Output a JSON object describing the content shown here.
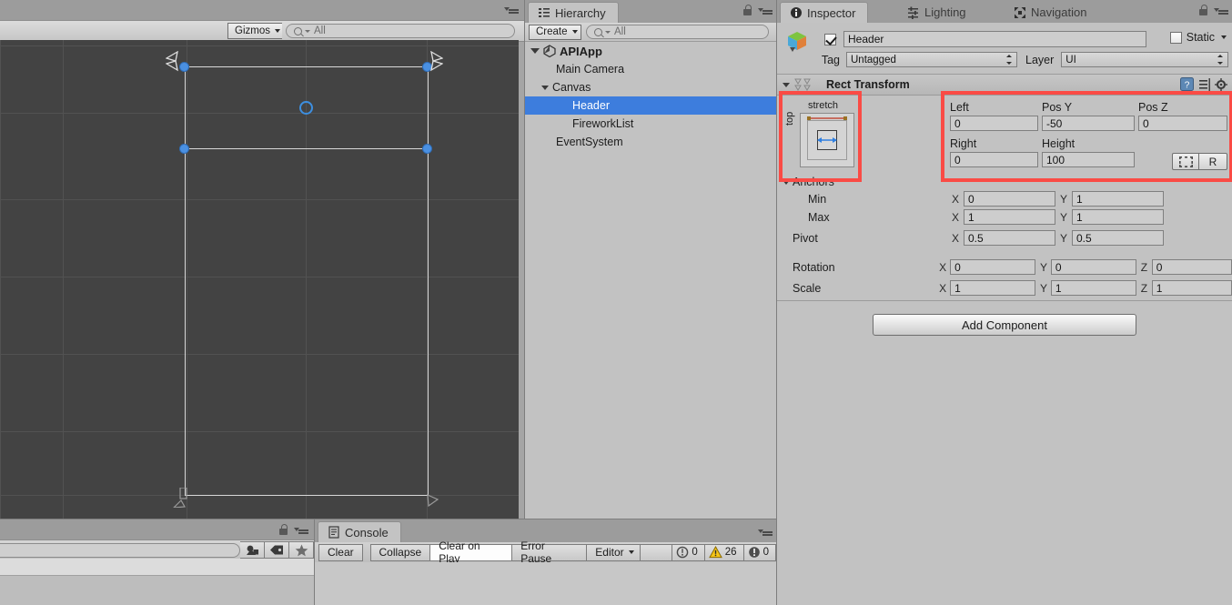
{
  "scene_view": {
    "gizmos_label": "Gizmos",
    "search_placeholder": "All",
    "search_value": ""
  },
  "hierarchy": {
    "tab_label": "Hierarchy",
    "create_label": "Create",
    "search_placeholder": "All",
    "search_value": "",
    "items": [
      {
        "label": "APIApp",
        "depth": 0,
        "expanded": true,
        "selected": false,
        "root": true
      },
      {
        "label": "Main Camera",
        "depth": 1,
        "expanded": null,
        "selected": false,
        "root": false
      },
      {
        "label": "Canvas",
        "depth": 1,
        "expanded": true,
        "selected": false,
        "root": false
      },
      {
        "label": "Header",
        "depth": 2,
        "expanded": null,
        "selected": true,
        "root": false
      },
      {
        "label": "FireworkList",
        "depth": 2,
        "expanded": null,
        "selected": false,
        "root": false
      },
      {
        "label": "EventSystem",
        "depth": 1,
        "expanded": null,
        "selected": false,
        "root": false
      }
    ]
  },
  "inspector": {
    "tabs": [
      {
        "label": "Inspector",
        "icon": "info-icon",
        "active": true
      },
      {
        "label": "Lighting",
        "icon": "lighting-icon",
        "active": false
      },
      {
        "label": "Navigation",
        "icon": "navigation-icon",
        "active": false
      }
    ],
    "object": {
      "enabled": true,
      "name": "Header",
      "static_label": "Static",
      "static_checked": false,
      "tag_label": "Tag",
      "tag_value": "Untagged",
      "layer_label": "Layer",
      "layer_value": "UI"
    },
    "rect_transform": {
      "title": "Rect Transform",
      "anchor_preset": {
        "horizontal_label": "stretch",
        "vertical_label": "top"
      },
      "fields": [
        {
          "label": "Left",
          "value": "0"
        },
        {
          "label": "Pos Y",
          "value": "-50"
        },
        {
          "label": "Pos Z",
          "value": "0"
        },
        {
          "label": "Right",
          "value": "0"
        },
        {
          "label": "Height",
          "value": "100"
        }
      ],
      "blueprint_button": "",
      "raw_button": "R",
      "anchors_label": "Anchors",
      "anchors": [
        {
          "label": "Min",
          "x": "0",
          "y": "1"
        },
        {
          "label": "Max",
          "x": "1",
          "y": "1"
        },
        {
          "label": "Pivot",
          "x": "0.5",
          "y": "0.5"
        }
      ],
      "transform_rows": [
        {
          "label": "Rotation",
          "x": "0",
          "y": "0",
          "z": "0"
        },
        {
          "label": "Scale",
          "x": "1",
          "y": "1",
          "z": "1"
        }
      ],
      "axis_x": "X",
      "axis_y": "Y",
      "axis_z": "Z"
    },
    "add_component_label": "Add Component",
    "highlight_color": "#fa4b45"
  },
  "project": {
    "search_placeholder": "",
    "search_value": "",
    "filter_icons": [
      "object-filter-icon",
      "label-filter-icon",
      "favorite-filter-icon"
    ]
  },
  "console": {
    "tab_label": "Console",
    "buttons": [
      {
        "label": "Clear",
        "toggled": false
      },
      {
        "label": "Collapse",
        "toggled": false
      },
      {
        "label": "Clear on Play",
        "toggled": true
      },
      {
        "label": "Error Pause",
        "toggled": false
      }
    ],
    "editor_label": "Editor",
    "counts": [
      {
        "icon": "log-icon",
        "value": "0"
      },
      {
        "icon": "warning-icon",
        "value": "26"
      },
      {
        "icon": "error-icon",
        "value": "0"
      }
    ]
  },
  "colors": {
    "selection_blue": "#3d7ddd",
    "handle_blue": "#4a90e2",
    "highlight_red": "#fa4b45",
    "scene_bg": "#434343",
    "panel_bg": "#c2c2c2"
  }
}
